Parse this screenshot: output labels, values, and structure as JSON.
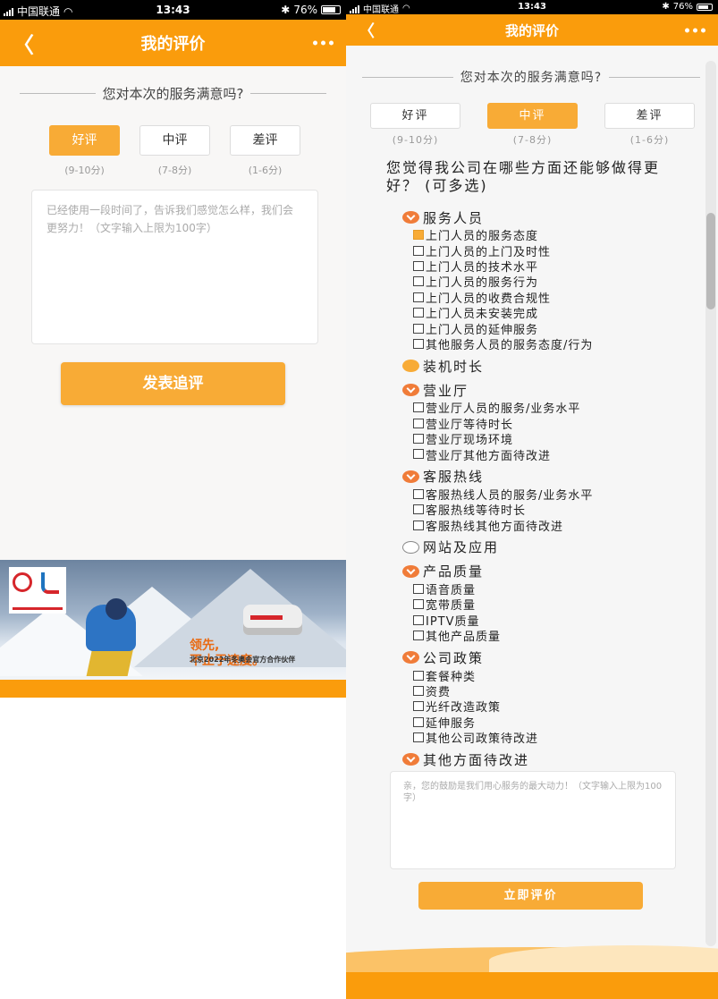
{
  "colors": {
    "brand": "#fa9c0c",
    "button": "#f8ab36",
    "chevron": "#f07c39"
  },
  "left": {
    "status": {
      "carrier": "中国联通",
      "time": "13:43",
      "battery": "76%"
    },
    "nav": {
      "back": "〈",
      "title": "我的评价"
    },
    "prompt": "您对本次的服务满意吗?",
    "choices": [
      {
        "label": "好评",
        "range": "(9-10分)"
      },
      {
        "label": "中评",
        "range": "(7-8分)"
      },
      {
        "label": "差评",
        "range": "(1-6分)"
      }
    ],
    "selected_choice": "好评",
    "textarea_placeholder": "已经使用一段时间了，告诉我们感觉怎么样，我们会更努力！（文字输入上限为100字）",
    "submit": "发表追评",
    "banner": {
      "slogan_1": "领先,",
      "slogan_2": "不止于速度。",
      "caption": "北京2022年冬奥会官方合作伙伴"
    }
  },
  "right": {
    "status": {
      "carrier": "中国联通",
      "time": "13:43",
      "battery": "76%"
    },
    "nav": {
      "back": "〈",
      "title": "我的评价"
    },
    "prompt": "您对本次的服务满意吗?",
    "choices": [
      {
        "label": "好评",
        "range": "(9-10分)"
      },
      {
        "label": "中评",
        "range": "(7-8分)"
      },
      {
        "label": "差评",
        "range": "(1-6分)"
      }
    ],
    "selected_choice": "中评",
    "question": "您觉得我公司在哪些方面还能够做得更好？ (可多选)",
    "groups": [
      {
        "title": "服务人员",
        "state": "expanded",
        "items": [
          {
            "label": "上门人员的服务态度",
            "checked": true
          },
          {
            "label": "上门人员的上门及时性",
            "checked": false
          },
          {
            "label": "上门人员的技术水平",
            "checked": false
          },
          {
            "label": "上门人员的服务行为",
            "checked": false
          },
          {
            "label": "上门人员的收费合规性",
            "checked": false
          },
          {
            "label": "上门人员未安装完成",
            "checked": false
          },
          {
            "label": "上门人员的延伸服务",
            "checked": false
          },
          {
            "label": "其他服务人员的服务态度/行为",
            "checked": false
          }
        ]
      },
      {
        "title": "装机时长",
        "state": "selected",
        "items": []
      },
      {
        "title": "营业厅",
        "state": "expanded",
        "items": [
          {
            "label": "营业厅人员的服务/业务水平",
            "checked": false
          },
          {
            "label": "营业厅等待时长",
            "checked": false
          },
          {
            "label": "营业厅现场环境",
            "checked": false
          },
          {
            "label": "营业厅其他方面待改进",
            "checked": false
          }
        ]
      },
      {
        "title": "客服热线",
        "state": "expanded",
        "items": [
          {
            "label": "客服热线人员的服务/业务水平",
            "checked": false
          },
          {
            "label": "客服热线等待时长",
            "checked": false
          },
          {
            "label": "客服热线其他方面待改进",
            "checked": false
          }
        ]
      },
      {
        "title": "网站及应用",
        "state": "unselected",
        "items": []
      },
      {
        "title": "产品质量",
        "state": "expanded",
        "items": [
          {
            "label": "语音质量",
            "checked": false
          },
          {
            "label": "宽带质量",
            "checked": false
          },
          {
            "label": "IPTV质量",
            "checked": false
          },
          {
            "label": "其他产品质量",
            "checked": false
          }
        ]
      },
      {
        "title": "公司政策",
        "state": "expanded",
        "items": [
          {
            "label": "套餐种类",
            "checked": false
          },
          {
            "label": "资费",
            "checked": false
          },
          {
            "label": "光纤改造政策",
            "checked": false
          },
          {
            "label": "延伸服务",
            "checked": false
          },
          {
            "label": "其他公司政策待改进",
            "checked": false
          }
        ]
      },
      {
        "title": "其他方面待改进",
        "state": "expanded",
        "items": []
      }
    ],
    "textarea_placeholder": "亲，您的鼓励是我们用心服务的最大动力！（文字输入上限为100字）",
    "submit": "立即评价"
  }
}
